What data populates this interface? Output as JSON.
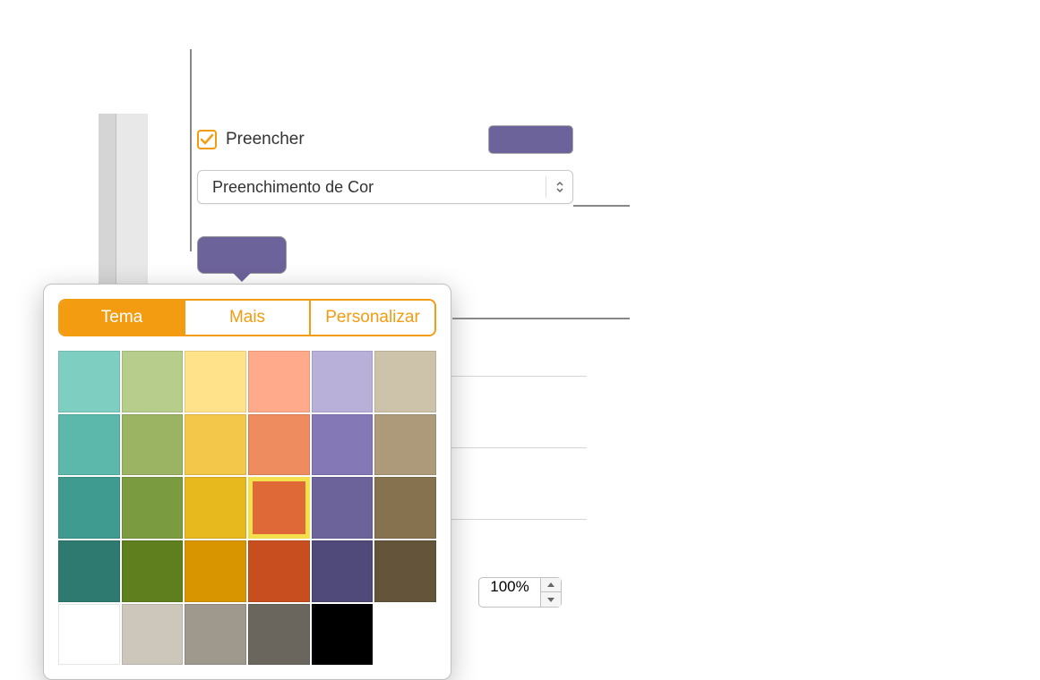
{
  "fill": {
    "checkbox_label": "Preencher",
    "checked": true,
    "preview_color": "#6d639b",
    "dropdown_value": "Preenchimento de Cor",
    "selected_color": "#6d639b",
    "opacity_value": "100%"
  },
  "color_picker": {
    "tabs": [
      {
        "label": "Tema",
        "active": true
      },
      {
        "label": "Mais",
        "active": false
      },
      {
        "label": "Personalizar",
        "active": false
      }
    ],
    "selected_index": 15,
    "colors": [
      "#7fcec2",
      "#b6cd8b",
      "#ffe28a",
      "#ffaa8a",
      "#b8b0d9",
      "#cdc3ab",
      "#5bb8aa",
      "#9bb464",
      "#f3c84a",
      "#ee8b5f",
      "#8478b7",
      "#ac9a7a",
      "#3f9a8f",
      "#7a9b3f",
      "#e8b81f",
      "#e06938",
      "#6d639b",
      "#86724f",
      "#2e7a70",
      "#5f7f1f",
      "#d89500",
      "#c94e1f",
      "#504a7a",
      "#63543a",
      "#ffffff",
      "#cdc7bb",
      "#9e988d",
      "#6b665d",
      "#000000",
      ""
    ]
  }
}
